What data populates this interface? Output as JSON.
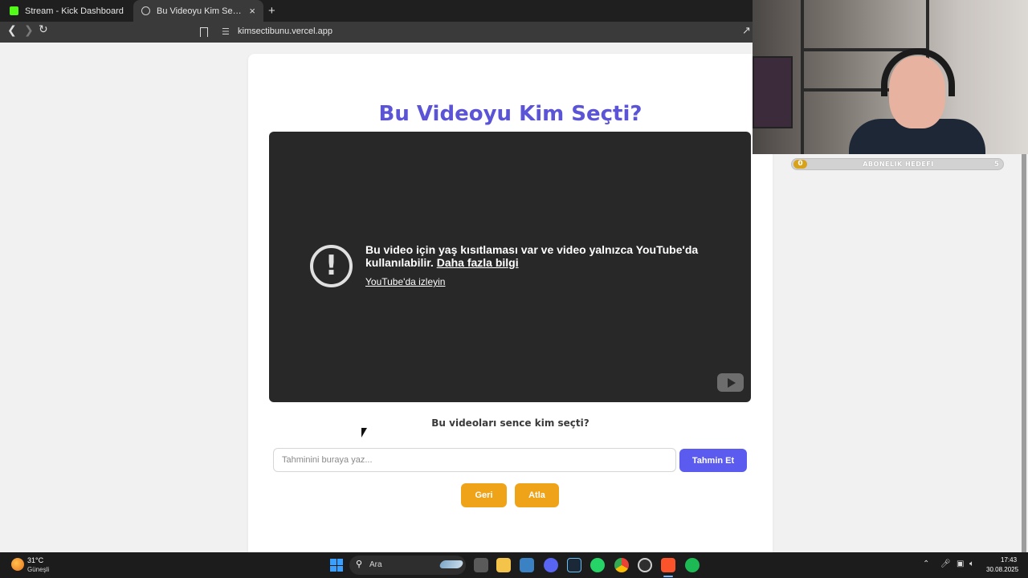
{
  "browser": {
    "tabs": [
      {
        "title": "Stream - Kick Dashboard",
        "active": false,
        "favicon_color": "#53fc18"
      },
      {
        "title": "Bu Videoyu Kim Seçti? - TEST",
        "active": true,
        "favicon_color": "#cfcfcf"
      }
    ],
    "new_tab_symbol": "+",
    "close_symbol": "×",
    "url": "kimsectibunu.vercel.app"
  },
  "page": {
    "title": "Bu Videoyu Kim Seçti?",
    "video": {
      "warning_text": "Bu video için yaş kısıtlaması var ve video yalnızca YouTube'da kullanılabilir.",
      "more_info_link": "Daha fazla bilgi",
      "watch_link": "YouTube'da izleyin"
    },
    "question": "Bu videoları sence kim seçti?",
    "guess_input": {
      "placeholder": "Tahminini buraya yaz...",
      "value": ""
    },
    "guess_button": "Tahmin Et",
    "back_button": "Geri",
    "skip_button": "Atla"
  },
  "overlay": {
    "subscription_goal": {
      "label": "ABONELIK HEDEFI",
      "current": "0",
      "target": "5",
      "progress": 0.0
    }
  },
  "taskbar": {
    "weather_temp": "31°C",
    "weather_desc": "Güneşli",
    "search_placeholder": "Ara",
    "time": "17:43",
    "date": "30.08.2025"
  },
  "colors": {
    "title": "#5b54d6",
    "guess_button": "#5b5bf0",
    "secondary_buttons": "#efa319",
    "video_background": "#282828"
  }
}
